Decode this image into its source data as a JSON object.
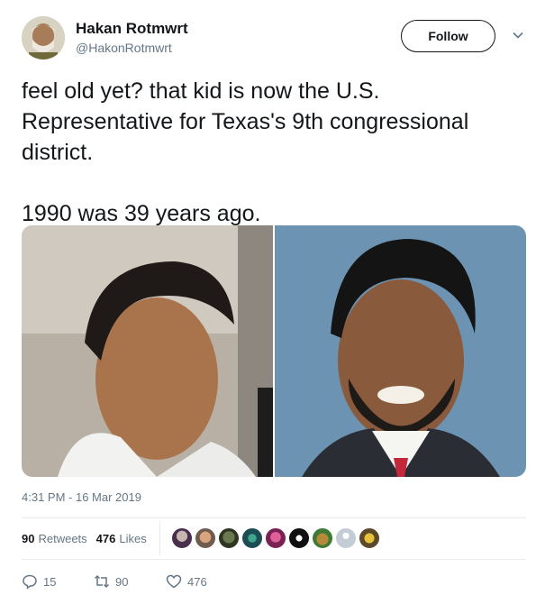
{
  "author": {
    "display_name": "Hakan Rotmwrt",
    "handle": "@HakonRotmwrt"
  },
  "follow_label": "Follow",
  "tweet": {
    "text": "feel old yet? that kid is now the U.S.\nRepresentative for Texas's 9th congressional\ndistrict.\n\n1990 was 39 years ago.",
    "timestamp": "4:31 PM - 16 Mar 2019"
  },
  "stats": {
    "retweets_count": "90",
    "retweets_label": "Retweets",
    "likes_count": "476",
    "likes_label": "Likes"
  },
  "actions": {
    "reply_count": "15",
    "retweet_count": "90",
    "like_count": "476"
  },
  "icons": [
    "caret-down-icon",
    "reply-icon",
    "retweet-icon",
    "heart-icon"
  ],
  "colors": {
    "text": "#14171a",
    "secondary": "#657786",
    "divider": "#e6ecf0"
  }
}
